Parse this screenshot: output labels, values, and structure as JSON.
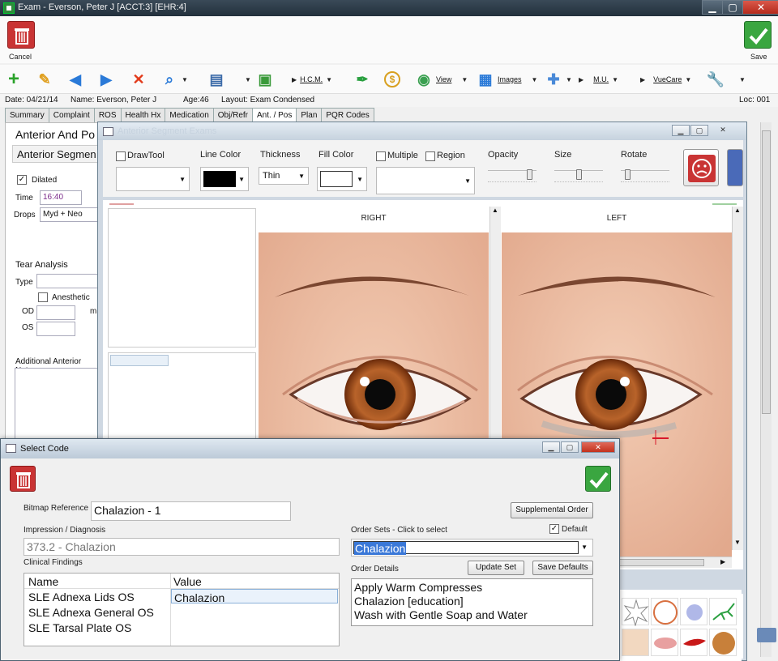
{
  "window": {
    "title": "Exam - Everson, Peter J [ACCT:3] [EHR:4]",
    "minimize": "▁",
    "maximize": "▢",
    "close": "✕"
  },
  "cmd": {
    "cancel_label": "Cancel",
    "save_label": "Save"
  },
  "toolbar": {
    "hcm": "H.C.M.",
    "view": "View",
    "images": "Images",
    "mu": "M.U.",
    "vuecare": "VueCare"
  },
  "info": {
    "date": "Date: 04/21/14",
    "name": "Name: Everson, Peter J",
    "age": "Age:46",
    "layout": "Layout: Exam Condensed",
    "loc": "Loc: 001"
  },
  "tabs": [
    "Summary",
    "Complaint",
    "ROS",
    "Health Hx",
    "Medication",
    "Obj/Refr",
    "Ant. / Pos",
    "Plan",
    "PQR Codes"
  ],
  "left": {
    "heading": "Anterior And Po",
    "subheading": "Anterior Segmen",
    "dilated_label": "Dilated",
    "time_label": "Time",
    "time_value": "16:40",
    "drops_label": "Drops",
    "drops_value": "Myd + Neo",
    "tear_heading": "Tear Analysis",
    "type_label": "Type",
    "anesthetic_label": "Anesthetic",
    "od_label": "OD",
    "os_label": "OS",
    "mi_label": "mi",
    "notes_label": "Additional Anterior Note"
  },
  "draw": {
    "title": "Anterior Segment Exams",
    "drawtool": "DrawTool",
    "line_color": "Line Color",
    "thickness": "Thickness",
    "thickness_value": "Thin",
    "fill_color": "Fill Color",
    "multiple": "Multiple",
    "region": "Region",
    "opacity": "Opacity",
    "size": "Size",
    "rotate": "Rotate",
    "opacity_level": 0.9,
    "size_level": 0.5,
    "rotate_level": 0.1,
    "right_label": "RIGHT",
    "left_label": "LEFT"
  },
  "select_code": {
    "title": "Select Code",
    "bitmap_label": "Bitmap Reference",
    "bitmap_value": "Chalazion - 1",
    "supplemental": "Supplemental Order",
    "impression_label": "Impression / Diagnosis",
    "impression_value": "373.2 - Chalazion",
    "order_sets_label": "Order Sets - Click to select",
    "default_label": "Default",
    "order_set_value": "Chalazion",
    "clinical_label": "Clinical Findings",
    "col_name": "Name",
    "col_value": "Value",
    "rows": [
      {
        "name": "SLE Adnexa Lids OS",
        "value": "Chalazion"
      },
      {
        "name": "SLE Adnexa General OS",
        "value": ""
      },
      {
        "name": "SLE Tarsal Plate OS",
        "value": ""
      }
    ],
    "order_details_label": "Order Details",
    "update_set": "Update Set",
    "save_defaults": "Save Defaults",
    "details": [
      "Apply Warm Compresses",
      "Chalazion [education]",
      "Wash with Gentle Soap and Water"
    ]
  },
  "colors": {
    "danger": "#c93434",
    "success": "#3aa640",
    "selection": "#3a78d8"
  }
}
